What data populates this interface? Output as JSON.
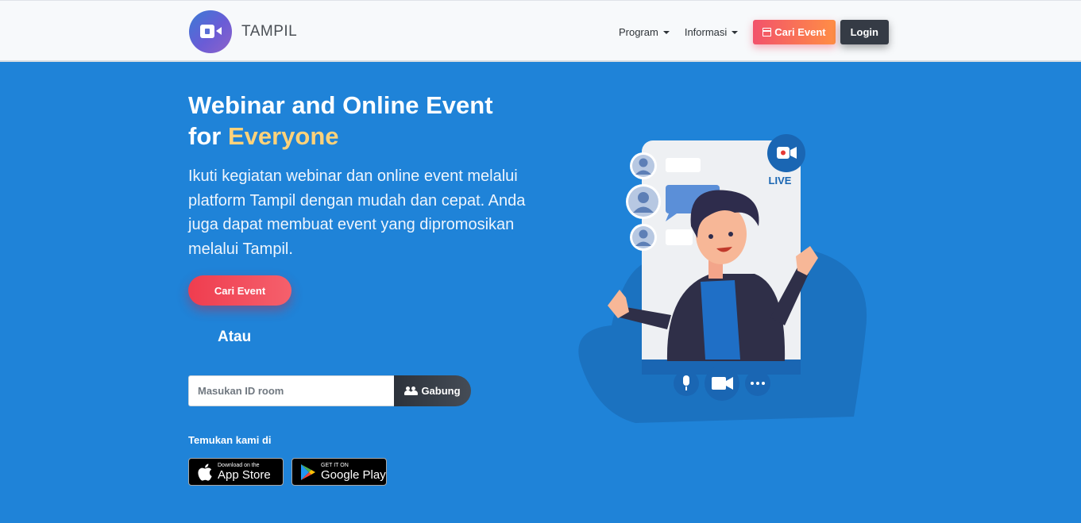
{
  "navbar": {
    "brand_name": "TAMPIL",
    "menu": [
      {
        "label": "Program"
      },
      {
        "label": "Informasi"
      }
    ],
    "cari_event_label": "Cari Event",
    "login_label": "Login"
  },
  "hero": {
    "title_line1": "Webinar and Online Event",
    "title_line2_prefix": "for ",
    "title_highlight": "Everyone",
    "description": "Ikuti kegiatan webinar dan online event melalui platform Tampil dengan mudah dan cepat. Anda juga dapat membuat event yang dipromosikan melalui Tampil.",
    "cari_event_label": "Cari Event",
    "atau_label": "Atau",
    "room_placeholder": "Masukan ID room",
    "room_value": "",
    "gabung_label": "Gabung",
    "temukan_label": "Temukan kami di"
  },
  "stores": {
    "apple": {
      "small": "Download on the",
      "big": "App Store"
    },
    "google": {
      "small": "GET IT ON",
      "big": "Google Play"
    }
  },
  "illustration": {
    "live_label": "LIVE"
  },
  "colors": {
    "hero_bg": "#1f83d8",
    "highlight": "#ffd27a",
    "accent_red": "#ef3d4f",
    "dark_button": "#353b45"
  }
}
